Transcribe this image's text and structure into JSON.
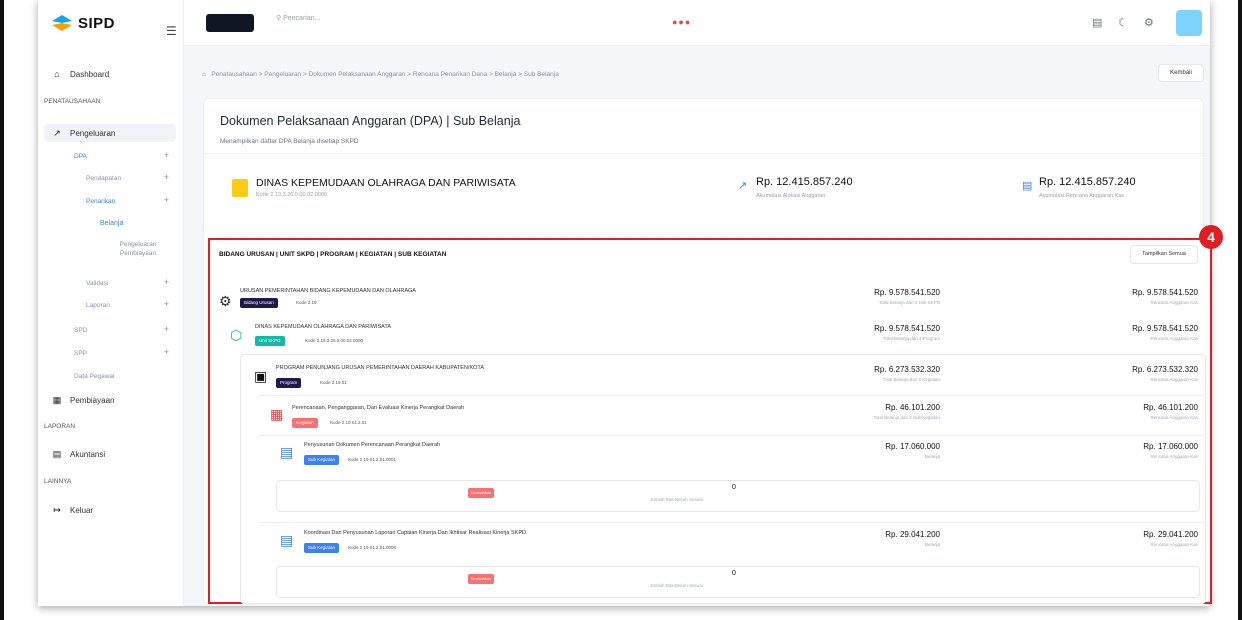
{
  "app": {
    "name": "SIPD"
  },
  "sidebar": {
    "dashboard": "Dashboard",
    "section_penatausahaan": "PENATAUSAHAAN",
    "pengeluaran": "Pengeluaran",
    "dpa": "DPA",
    "pendapatan": "Pendapatan",
    "penarikan": "Penarikan",
    "belanja": "Belanja",
    "pengeluaran_pembiayaan": "Pengeluaran Pembiayaan",
    "validasi": "Validasi",
    "laporan_sub": "Laporan",
    "spd": "SPD",
    "spp": "SPP",
    "data_pegawai": "Data Pegawai",
    "pembiayaan": "Pembiayaan",
    "section_laporan": "LAPORAN",
    "akuntansi": "Akuntansi",
    "section_lainnya": "LAINNYA",
    "keluar": "Keluar"
  },
  "topbar": {
    "search_placeholder": "Pencarian..."
  },
  "breadcrumb": "Penatausahaan  >  Pengeluaran  >  Dokumen Pelaksanaan Anggaran  >  Rencana Penarikan Dana  >  Belanja  >  Sub Belanja",
  "back_button": "Kembali",
  "page": {
    "title": "Dokumen Pelaksanaan Anggaran (DPA) | Sub Belanja",
    "subtitle": "Menampilkan daftar DPA Belanja disetiap SKPD"
  },
  "skpd": {
    "name": "DINAS KEPEMUDAAN OLAHRAGA DAN PARIWISATA",
    "code": "Kode 2.19.3.26.0.00.02.0000",
    "stat1_value": "Rp. 12.415.857.240",
    "stat1_label": "Akumulasi Alokasi Anggaran",
    "stat2_value": "Rp. 12.415.857.240",
    "stat2_label": "Akumulasi Rencana Anggaran Kas"
  },
  "callout_number": "4",
  "table": {
    "header": "BIDANG URUSAN | UNIT SKPD | PROGRAM | KEGIATAN | SUB KEGIATAN",
    "show_all": "Tampilkan Semua",
    "rows": [
      {
        "title": "URUSAN PEMERINTAHAN BIDANG KEPEMUDAAN DAN OLAHRAGA",
        "tag": "Bidang Urusan",
        "kode": "Kode 2.19",
        "value": "Rp. 9.578.541.520",
        "label": "Total Belanja dari 1 Unit SKPD",
        "rak": "Rp. 9.578.541.520",
        "rak_label": "Rencana Anggaran Kas"
      },
      {
        "title": "DINAS KEPEMUDAAN OLAHRAGA DAN PARIWISATA",
        "tag": "Unit SKPD",
        "kode": "Kode 2.19.3.26.0.00.02.0000",
        "value": "Rp. 9.578.541.520",
        "label": "Total Belanja dari 3 Program",
        "rak": "Rp. 9.578.541.520",
        "rak_label": "Rencana Anggaran Kas"
      },
      {
        "title": "PROGRAM PENUNJANG URUSAN PEMERINTAHAN DAERAH KABUPATEN/KOTA",
        "tag": "Program",
        "kode": "Kode 2.19.01",
        "value": "Rp. 6.273.532.320",
        "label": "Total Belanja dari 8 Kegiatan",
        "rak": "Rp. 6.273.532.320",
        "rak_label": "Rencana Anggaran Kas"
      },
      {
        "title": "Perencanaan, Penganggaran, Dan Evaluasi Kinerja Perangkat Daerah",
        "tag": "Kegiatan",
        "kode": "Kode 2.19.01.2.01",
        "value": "Rp. 46.101.200",
        "label": "Total Belanja dari 2 Sub Kegiatan",
        "rak": "Rp. 46.101.200",
        "rak_label": "Rencana Anggaran Kas"
      },
      {
        "title": "Penyusunan Dokumen Perencanaan Perangkat Daerah",
        "tag": "Sub Kegiatan",
        "kode": "Kode 2.19.01.2.01.0001",
        "value": "Rp. 17.060.000",
        "label": "Belanja",
        "rak": "Rp. 17.060.000",
        "rak_label": "Rencana Anggaran Kas"
      },
      {
        "title": "Koordinasi Dan Penyusunan Laporan Capaian Kinerja Dan Ikhtisar Realisasi Kinerja SKPD",
        "tag": "Sub Kegiatan",
        "kode": "Kode 2.19.01.2.01.0006",
        "value": "Rp. 29.041.200",
        "label": "Belanja",
        "rak": "Rp. 29.041.200",
        "rak_label": "Rencana Anggaran Kas"
      }
    ],
    "panel1": {
      "button": "Tambahkan",
      "count": "0",
      "label": "Jumlah Rak Belum Sesuai"
    },
    "panel2": {
      "button": "Tambahkan",
      "count": "0",
      "label": "Jumlah Rak Belum Sesuai"
    }
  },
  "colors": {
    "accent": "#3b82f6",
    "highlight": "#e11d22",
    "program_tag": "#1e1b4b",
    "kegiatan_tag": "#f87171",
    "unit_tag": "#14b8a6",
    "sub_tag": "#3b82f6"
  }
}
